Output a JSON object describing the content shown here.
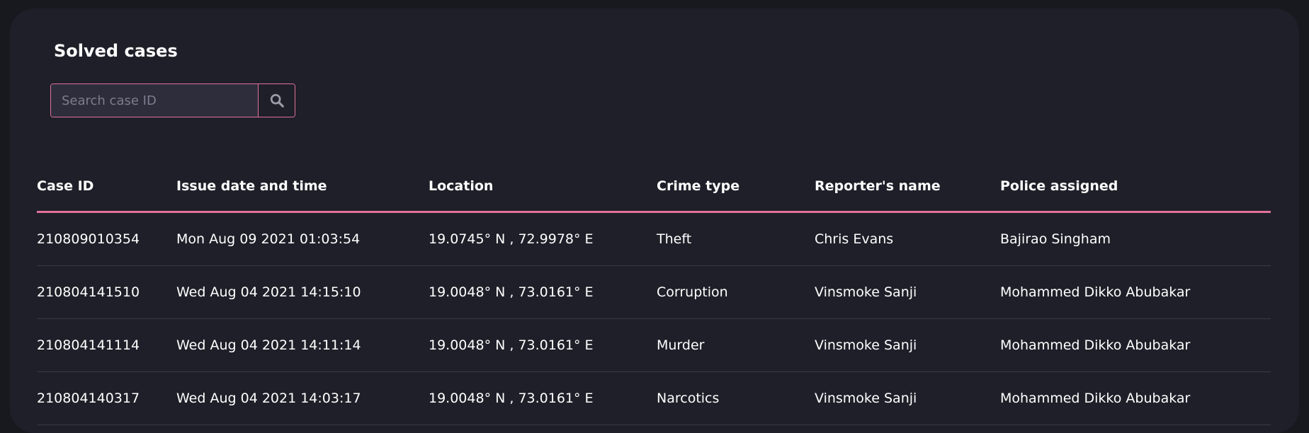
{
  "panel": {
    "title": "Solved cases"
  },
  "search": {
    "placeholder": "Search case ID",
    "icon": "search-icon"
  },
  "colors": {
    "accent": "#e0729a",
    "background": "#18181f",
    "card": "#1f1f29",
    "input": "#2d2d3c"
  },
  "table": {
    "headers": [
      "Case ID",
      "Issue date and time",
      "Location",
      "Crime type",
      "Reporter's name",
      "Police assigned"
    ],
    "rows": [
      [
        "210809010354",
        "Mon Aug 09 2021 01:03:54",
        "19.0745° N , 72.9978° E",
        "Theft",
        "Chris Evans",
        "Bajirao Singham"
      ],
      [
        "210804141510",
        "Wed Aug 04 2021 14:15:10",
        "19.0048° N , 73.0161° E",
        "Corruption",
        "Vinsmoke Sanji",
        "Mohammed Dikko Abubakar"
      ],
      [
        "210804141114",
        "Wed Aug 04 2021 14:11:14",
        "19.0048° N , 73.0161° E",
        "Murder",
        "Vinsmoke Sanji",
        "Mohammed Dikko Abubakar"
      ],
      [
        "210804140317",
        "Wed Aug 04 2021 14:03:17",
        "19.0048° N , 73.0161° E",
        "Narcotics",
        "Vinsmoke Sanji",
        "Mohammed Dikko Abubakar"
      ]
    ]
  }
}
